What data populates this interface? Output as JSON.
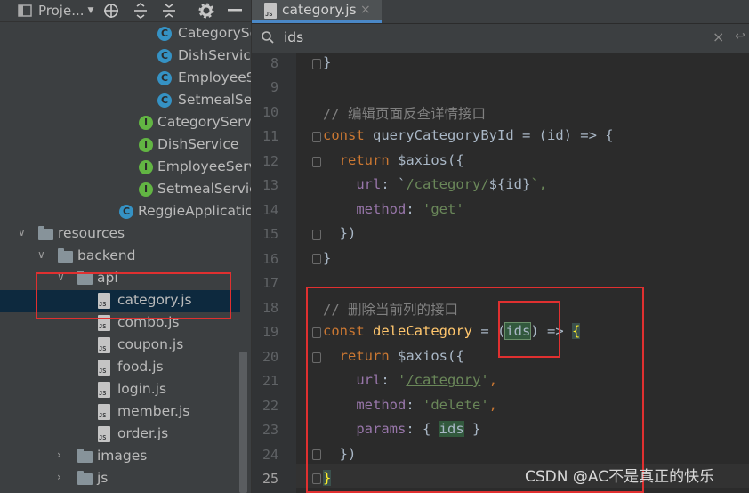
{
  "project_panel": {
    "title": "Proje...",
    "items": [
      {
        "label": "CategorySe",
        "kind": "class"
      },
      {
        "label": "DishServiceI",
        "kind": "class"
      },
      {
        "label": "EmployeeS",
        "kind": "class"
      },
      {
        "label": "SetmealSer",
        "kind": "class"
      },
      {
        "label": "CategoryServi",
        "kind": "interface"
      },
      {
        "label": "DishService",
        "kind": "interface"
      },
      {
        "label": "EmployeeServ",
        "kind": "interface"
      },
      {
        "label": "SetmealServic",
        "kind": "interface"
      },
      {
        "label": "ReggieApplicatio",
        "kind": "app"
      },
      {
        "label": "resources",
        "kind": "folder"
      },
      {
        "label": "backend",
        "kind": "folder"
      },
      {
        "label": "api",
        "kind": "folder"
      },
      {
        "label": "category.js",
        "kind": "js"
      },
      {
        "label": "combo.js",
        "kind": "js"
      },
      {
        "label": "coupon.js",
        "kind": "js"
      },
      {
        "label": "food.js",
        "kind": "js"
      },
      {
        "label": "login.js",
        "kind": "js"
      },
      {
        "label": "member.js",
        "kind": "js"
      },
      {
        "label": "order.js",
        "kind": "js"
      },
      {
        "label": "images",
        "kind": "folder"
      },
      {
        "label": "js",
        "kind": "folder"
      }
    ]
  },
  "editor": {
    "tab_label": "category.js",
    "search_value": "ids",
    "line_numbers": [
      "8",
      "9",
      "10",
      "11",
      "12",
      "13",
      "14",
      "15",
      "16",
      "17",
      "18",
      "19",
      "20",
      "21",
      "22",
      "23",
      "24",
      "25"
    ],
    "lines": {
      "l8": "}",
      "l10": "// 编辑页面反查详情接口",
      "l11_kw": "const",
      "l11_fn": "queryCategoryById",
      "l11_rest": " = (id) => {",
      "l12_kw": "return",
      "l12_fn": "$axios",
      "l12_rest": "({",
      "l13_pr": "url",
      "l13_p1": ": `",
      "l13_path": "/category/",
      "l13_var": "${id}",
      "l13_end": "`,",
      "l14_pr": "method",
      "l14_p": ": ",
      "l14_st": "'get'",
      "l15": "})",
      "l16": "}",
      "l18": "// 删除当前列的接口",
      "l19_kw": "const",
      "l19_fn": "deleCategory",
      "l19_a": " = (",
      "l19_ids": "ids",
      "l19_b": ") => ",
      "l19_brace": "{",
      "l20_kw": "return",
      "l20_fn": "$axios",
      "l20_rest": "({",
      "l21_pr": "url",
      "l21_p": ": ",
      "l21_q1": "'",
      "l21_path": "/category",
      "l21_q2": "'",
      "l21_end": ",",
      "l22_pr": "method",
      "l22_p": ": ",
      "l22_st": "'delete'",
      "l22_end": ",",
      "l23_pr": "params",
      "l23_a": ": { ",
      "l23_ids": "ids",
      "l23_b": " }",
      "l24": "})",
      "l25": "}"
    }
  },
  "watermark": "CSDN @AC不是真正的快乐",
  "colors": {
    "keyword": "#cc7832",
    "function": "#ffc66d",
    "string": "#6a8759",
    "property": "#9876aa",
    "comment": "#808080",
    "annotation": "#e03030"
  }
}
